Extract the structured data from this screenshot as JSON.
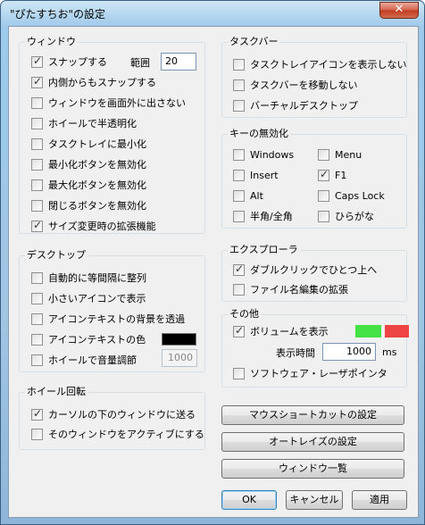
{
  "window": {
    "title": "\"ぴたすちお\"の設定",
    "close_glyph": "✕"
  },
  "window_group": {
    "title": "ウィンドウ",
    "items": [
      {
        "label": "スナップする",
        "checked": true
      },
      {
        "label": "内側からもスナップする",
        "checked": true
      },
      {
        "label": "ウィンドウを画面外に出さない",
        "checked": false
      },
      {
        "label": "ホイールで半透明化",
        "checked": false
      },
      {
        "label": "タスクトレイに最小化",
        "checked": false
      },
      {
        "label": "最小化ボタンを無効化",
        "checked": false
      },
      {
        "label": "最大化ボタンを無効化",
        "checked": false
      },
      {
        "label": "閉じるボタンを無効化",
        "checked": false
      },
      {
        "label": "サイズ変更時の拡張機能",
        "checked": true
      }
    ],
    "range_label": "範囲",
    "range_value": "20"
  },
  "taskbar_group": {
    "title": "タスクバー",
    "items": [
      {
        "label": "タスクトレイアイコンを表示しない",
        "checked": false
      },
      {
        "label": "タスクバーを移動しない",
        "checked": false
      },
      {
        "label": "バーチャルデスクトップ",
        "checked": false
      }
    ]
  },
  "keys_group": {
    "title": "キーの無効化",
    "items": [
      {
        "label": "Windows",
        "checked": false
      },
      {
        "label": "Menu",
        "checked": false
      },
      {
        "label": "Insert",
        "checked": false
      },
      {
        "label": "F1",
        "checked": true
      },
      {
        "label": "Alt",
        "checked": false
      },
      {
        "label": "Caps Lock",
        "checked": false
      },
      {
        "label": "半角/全角",
        "checked": false
      },
      {
        "label": "ひらがな",
        "checked": false
      }
    ]
  },
  "desktop_group": {
    "title": "デスクトップ",
    "items": [
      {
        "label": "自動的に等間隔に整列",
        "checked": false
      },
      {
        "label": "小さいアイコンで表示",
        "checked": false
      },
      {
        "label": "アイコンテキストの背景を透過",
        "checked": false
      },
      {
        "label": "アイコンテキストの色",
        "checked": false
      },
      {
        "label": "ホイールで音量調節",
        "checked": false
      }
    ],
    "icon_text_color": "#000000",
    "volume_step_value": "1000"
  },
  "explorer_group": {
    "title": "エクスプローラ",
    "items": [
      {
        "label": "ダブルクリックでひとつ上へ",
        "checked": true
      },
      {
        "label": "ファイル名編集の拡張",
        "checked": false
      }
    ]
  },
  "wheel_group": {
    "title": "ホイール回転",
    "items": [
      {
        "label": "カーソルの下のウィンドウに送る",
        "checked": true
      },
      {
        "label": "そのウィンドウをアクティブにする",
        "checked": false
      }
    ]
  },
  "other_group": {
    "title": "その他",
    "items": [
      {
        "label": "ボリュームを表示",
        "checked": true
      },
      {
        "label": "ソフトウェア・レーザポインタ",
        "checked": false
      }
    ],
    "display_time_label": "表示時間",
    "display_time_value": "1000",
    "display_time_unit": "ms",
    "color_swatch_1": "#44e244",
    "color_swatch_2": "#ef4444"
  },
  "buttons": {
    "mouse_shortcut": "マウスショートカットの設定",
    "auto_raise": "オートレイズの設定",
    "window_list": "ウィンドウ一覧",
    "ok": "OK",
    "cancel": "キャンセル",
    "apply": "適用"
  }
}
